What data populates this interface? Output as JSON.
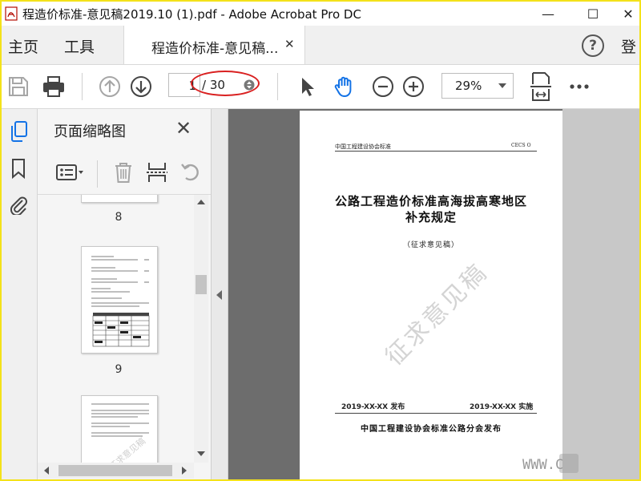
{
  "window": {
    "title": "程造价标准-意见稿2019.10 (1).pdf - Adobe Acrobat Pro DC",
    "minimize_glyph": "—",
    "maximize_glyph": "☐",
    "close_glyph": "✕"
  },
  "menu": {
    "home": "主页",
    "tools": "工具",
    "tab_label": "程造价标准-意见稿...",
    "tab_close": "✕",
    "help": "?",
    "login": "登"
  },
  "toolbar": {
    "icons": [
      "save-icon",
      "print-icon",
      "page-up-icon",
      "page-down-icon",
      "select-arrow-icon",
      "hand-icon",
      "zoom-out-icon",
      "zoom-in-icon",
      "fit-page-icon",
      "more-icon"
    ],
    "current_page": "1",
    "total_pages": "/ 30",
    "zoom": "29%",
    "annotation_color": "#d92020"
  },
  "thumbnails": {
    "title": "页面缩略图",
    "close_glyph": "✕",
    "pages": [
      {
        "number": "8"
      },
      {
        "number": "9"
      }
    ]
  },
  "document": {
    "header_left": "中国工程建设协会标准",
    "header_right": "CECS O",
    "title_line1": "公路工程造价标准高海拔高寒地区",
    "title_line2": "补充规定",
    "subtitle": "（征求意见稿）",
    "watermark": "征求意见稿",
    "date_publish": "2019-XX-XX  发布",
    "date_effective": "2019-XX-XX  实施",
    "publisher": "中国工程建设协会标准公路分会发布"
  },
  "site_watermark": "WWW.C",
  "colors": {
    "frame": "#f4e21a",
    "accent_blue": "#1473e6",
    "canvas_gray": "#6d6d6d"
  }
}
